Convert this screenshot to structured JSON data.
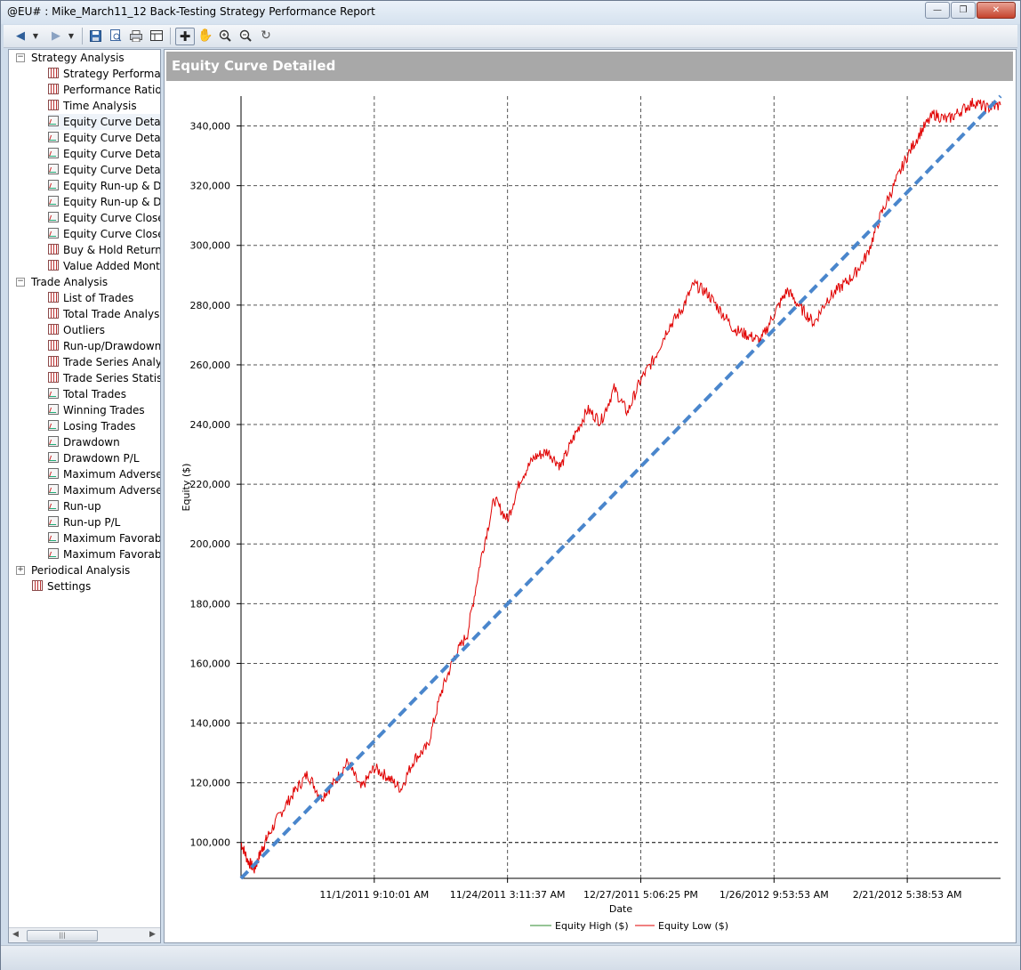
{
  "window": {
    "title": "@EU# : Mike_March11_12 Back-Testing Strategy Performance Report"
  },
  "icons": {
    "back": "back-arrow-icon",
    "forward": "forward-arrow-icon",
    "save": "save-icon",
    "preview": "print-preview-icon",
    "print": "print-icon",
    "layout": "page-layout-icon",
    "select": "crosshair-cursor-icon",
    "pan": "hand-pan-icon",
    "zoom_in": "zoom-in-icon",
    "zoom_out": "zoom-out-icon",
    "reset": "reset-zoom-icon"
  },
  "tree": {
    "strategy_analysis": {
      "label": "Strategy Analysis",
      "items": [
        "Strategy Performance",
        "Performance Ratios",
        "Time Analysis",
        "Equity Curve Detailed",
        "Equity Curve Detailed",
        "Equity Curve Detailed",
        "Equity Curve Detailed",
        "Equity Run-up & Drawdown",
        "Equity Run-up & Drawdown",
        "Equity Curve Close To Close",
        "Equity Curve Close To Close",
        "Buy & Hold Return",
        "Value Added Monthly"
      ]
    },
    "trade_analysis": {
      "label": "Trade Analysis",
      "items": [
        "List of Trades",
        "Total Trade Analysis",
        "Outliers",
        "Run-up/Drawdown",
        "Trade Series Analysis",
        "Trade Series Statistics",
        "Total Trades",
        "Winning Trades",
        "Losing Trades",
        "Drawdown",
        "Drawdown P/L",
        "Maximum Adverse Excursion",
        "Maximum Adverse Excursion",
        "Run-up",
        "Run-up P/L",
        "Maximum Favorable Excursion",
        "Maximum Favorable Excursion"
      ]
    },
    "periodical_analysis": {
      "label": "Periodical Analysis"
    },
    "settings": {
      "label": "Settings"
    },
    "selected": "Equity Curve Detailed"
  },
  "panel": {
    "title": "Equity Curve Detailed"
  },
  "chart_data": {
    "type": "line",
    "title": "Equity Curve Detailed",
    "xlabel": "Date",
    "ylabel": "Equity ($)",
    "ylim": [
      88000,
      350000
    ],
    "yticks": [
      100000,
      120000,
      140000,
      160000,
      180000,
      200000,
      220000,
      240000,
      260000,
      280000,
      300000,
      320000,
      340000
    ],
    "ytick_labels": [
      "100,000",
      "120,000",
      "140,000",
      "160,000",
      "180,000",
      "200,000",
      "220,000",
      "240,000",
      "260,000",
      "280,000",
      "300,000",
      "320,000",
      "340,000"
    ],
    "xtick_labels": [
      "11/1/2011 9:10:01 AM",
      "11/24/2011 3:11:37 AM",
      "12/27/2011 5:06:25 PM",
      "1/26/2012 9:53:53 AM",
      "2/21/2012 5:38:53 AM"
    ],
    "xtick_positions": [
      1,
      2,
      3,
      4,
      5
    ],
    "xlim": [
      0,
      5.7
    ],
    "grid": true,
    "legend": {
      "position": "bottom-center",
      "entries": [
        "Equity High ($)",
        "Equity Low ($)"
      ]
    },
    "colors": {
      "equity_high": "#2e8b2e",
      "equity_low": "#e00000",
      "trend": "#4a86cc"
    },
    "series": [
      {
        "name": "Equity Low ($)",
        "x": [
          0,
          0.05,
          0.1,
          0.15,
          0.2,
          0.3,
          0.4,
          0.5,
          0.6,
          0.7,
          0.8,
          0.9,
          1.0,
          1.1,
          1.2,
          1.3,
          1.4,
          1.5,
          1.6,
          1.7,
          1.8,
          1.9,
          2.0,
          2.1,
          2.2,
          2.3,
          2.4,
          2.5,
          2.6,
          2.7,
          2.8,
          2.9,
          3.0,
          3.1,
          3.2,
          3.3,
          3.4,
          3.5,
          3.6,
          3.7,
          3.8,
          3.9,
          4.0,
          4.1,
          4.2,
          4.3,
          4.4,
          4.5,
          4.6,
          4.7,
          4.8,
          4.9,
          5.0,
          5.1,
          5.2,
          5.3,
          5.4,
          5.5,
          5.6,
          5.7
        ],
        "values": [
          100000,
          94000,
          91000,
          97000,
          102000,
          110000,
          117000,
          123000,
          115000,
          120000,
          127000,
          118000,
          125000,
          122000,
          118000,
          128000,
          132000,
          150000,
          162000,
          170000,
          195000,
          215000,
          208000,
          222000,
          229000,
          231000,
          226000,
          236000,
          245000,
          241000,
          252000,
          244000,
          255000,
          262000,
          272000,
          278000,
          287000,
          284000,
          278000,
          272000,
          270000,
          268000,
          277000,
          285000,
          279000,
          274000,
          282000,
          286000,
          290000,
          297000,
          310000,
          320000,
          330000,
          338000,
          344000,
          342000,
          345000,
          348000,
          346000,
          347000
        ],
        "color": "#e00000"
      }
    ],
    "trend_line": {
      "x": [
        0,
        5.7
      ],
      "values": [
        88000,
        350000
      ],
      "style": "dashed"
    }
  }
}
